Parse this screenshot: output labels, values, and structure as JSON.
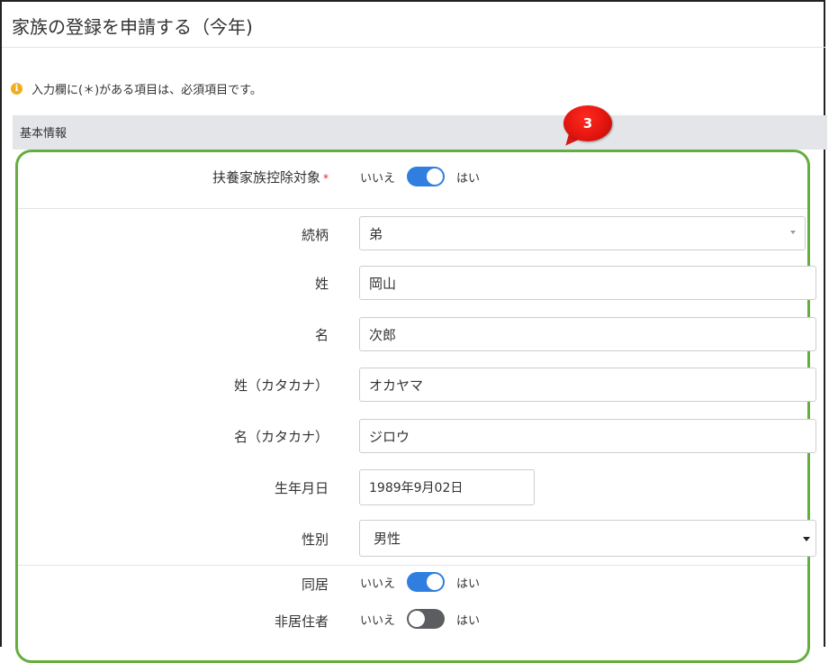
{
  "page": {
    "title": "家族の登録を申請する（今年)",
    "notice": "入力欄に(＊)がある項目は、必須項目です。",
    "info_icon": "info-circle-icon",
    "section_title": "基本情報",
    "callout_number": "3"
  },
  "colors": {
    "accent_green": "#64ae3d",
    "toggle_on": "#2f7ee0",
    "toggle_off": "#5b5d60",
    "callout_red": "#e3160f",
    "required": "#e0262b"
  },
  "form": {
    "dependent": {
      "label": "扶養家族控除対象",
      "required_mark": "*",
      "no_label": "いいえ",
      "yes_label": "はい",
      "value": true
    },
    "relationship": {
      "label": "続柄",
      "value": "弟"
    },
    "last_name": {
      "label": "姓",
      "value": "岡山"
    },
    "first_name": {
      "label": "名",
      "value": "次郎"
    },
    "last_name_kana": {
      "label": "姓（カタカナ）",
      "value": "オカヤマ"
    },
    "first_name_kana": {
      "label": "名（カタカナ）",
      "value": "ジロウ"
    },
    "birthdate": {
      "label": "生年月日",
      "value": "1989年9月02日"
    },
    "gender": {
      "label": "性別",
      "value": "男性"
    },
    "cohabiting": {
      "label": "同居",
      "no_label": "いいえ",
      "yes_label": "はい",
      "value": true
    },
    "non_resident": {
      "label": "非居住者",
      "no_label": "いいえ",
      "yes_label": "はい",
      "value": false
    }
  }
}
